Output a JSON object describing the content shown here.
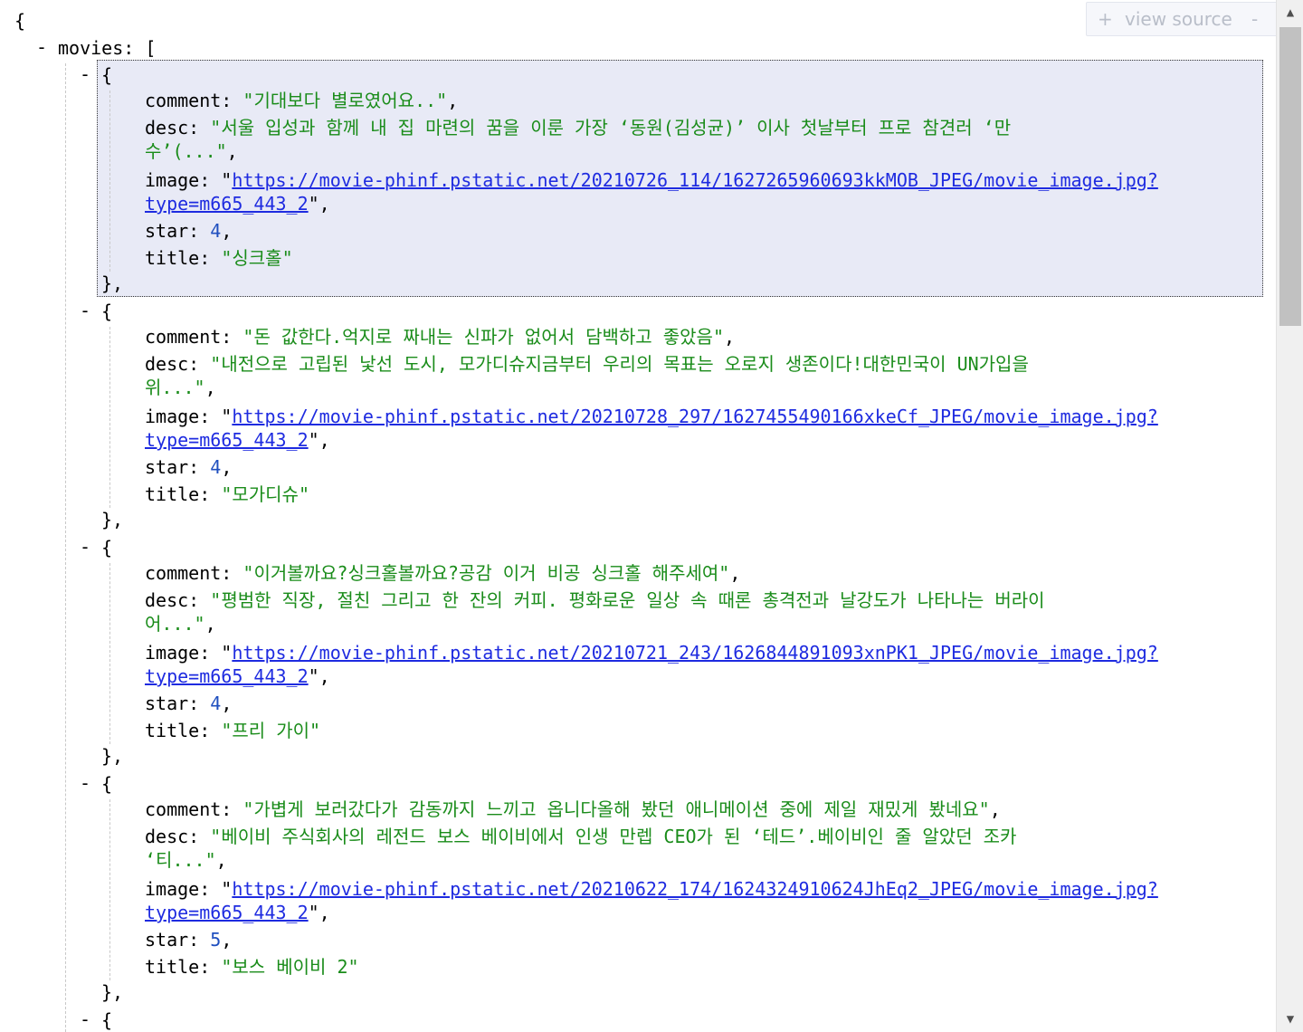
{
  "toolbar": {
    "plus": "+",
    "label": "view source",
    "minus": "-"
  },
  "root_open": "{",
  "movies_key": "movies",
  "movies_open": "[",
  "collapse_symbol": "-",
  "movies": [
    {
      "comment": "기대보다 별로였어요..",
      "desc_line1": "서울 입성과 함께 내 집 마련의 꿈을 이룬 가장 ‘동원(김성균)’ 이사 첫날부터 프로 참견러 ‘만",
      "desc_line2": "수’(...",
      "image_line1": "https://movie-phinf.pstatic.net/20210726_114/1627265960693kkMOB_JPEG/movie_image.jpg?",
      "image_line2": "type=m665_443_2",
      "star": "4",
      "title": "싱크홀"
    },
    {
      "comment": "돈 값한다.억지로 짜내는 신파가 없어서 담백하고 좋았음",
      "desc_line1": "내전으로 고립된 낯선 도시, 모가디슈지금부터 우리의 목표는 오로지 생존이다!대한민국이 UN가입을",
      "desc_line2": "위...",
      "image_line1": "https://movie-phinf.pstatic.net/20210728_297/1627455490166xkeCf_JPEG/movie_image.jpg?",
      "image_line2": "type=m665_443_2",
      "star": "4",
      "title": "모가디슈"
    },
    {
      "comment": "이거볼까요?싱크홀볼까요?공감 이거 비공 싱크홀 해주세여",
      "desc_line1": "평범한 직장, 절친 그리고 한 잔의 커피. 평화로운 일상 속 때론 총격전과 날강도가 나타나는 버라이",
      "desc_line2": "어...",
      "image_line1": "https://movie-phinf.pstatic.net/20210721_243/1626844891093xnPK1_JPEG/movie_image.jpg?",
      "image_line2": "type=m665_443_2",
      "star": "4",
      "title": "프리 가이"
    },
    {
      "comment": "가볍게 보러갔다가 감동까지 느끼고 옵니다올해 봤던 애니메이션 중에 제일 재밌게 봤네요",
      "desc_line1": "베이비 주식회사의 레전드 보스 베이비에서 인생 만렙 CEO가 된 ‘테드’.베이비인 줄 알았던 조카",
      "desc_line2": "‘티...",
      "image_line1": "https://movie-phinf.pstatic.net/20210622_174/1624324910624JhEq2_JPEG/movie_image.jpg?",
      "image_line2": "type=m665_443_2",
      "star": "5",
      "title": "보스 베이비 2"
    }
  ]
}
